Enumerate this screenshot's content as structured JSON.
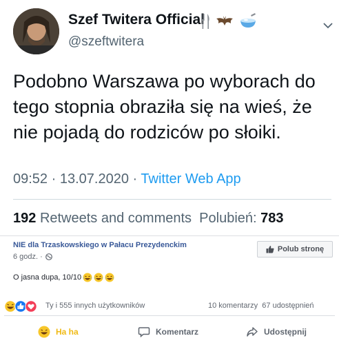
{
  "tweet": {
    "display_name": "Szef Twitera Official",
    "name_emojis": [
      "fork-knife-icon",
      "bat-icon",
      "bowl-icon"
    ],
    "handle": "@szeftwitera",
    "text": "Podobno Warszawa po wyborach do tego stopnia obraziła się na wieś, że nie pojadą do rodziców po słoiki.",
    "time": "09:52",
    "date": "13.07.2020",
    "separator": "·",
    "source": "Twitter Web App",
    "retweets_count": "192",
    "retweets_label": "Retweets and comments",
    "likes_label": "Polubień:",
    "likes_count": "783"
  },
  "facebook": {
    "page_name": "NIE dla Trzaskowskiego w Pałacu Prezydenckim",
    "post_time": "6 godz. ·",
    "like_page_label": "Polub stronę",
    "post_text": "O jasna dupa, 10/10",
    "reactions_text": "Ty i 555 innych użytkowników",
    "comments": "10 komentarzy",
    "shares": "67 udostępnień",
    "actions": {
      "haha": "Ha ha",
      "comment": "Komentarz",
      "share": "Udostępnij"
    },
    "colors": {
      "link": "#385898",
      "haha": "#f0ba15",
      "like_blue": "#1877f2",
      "love_red": "#f33e58"
    }
  }
}
